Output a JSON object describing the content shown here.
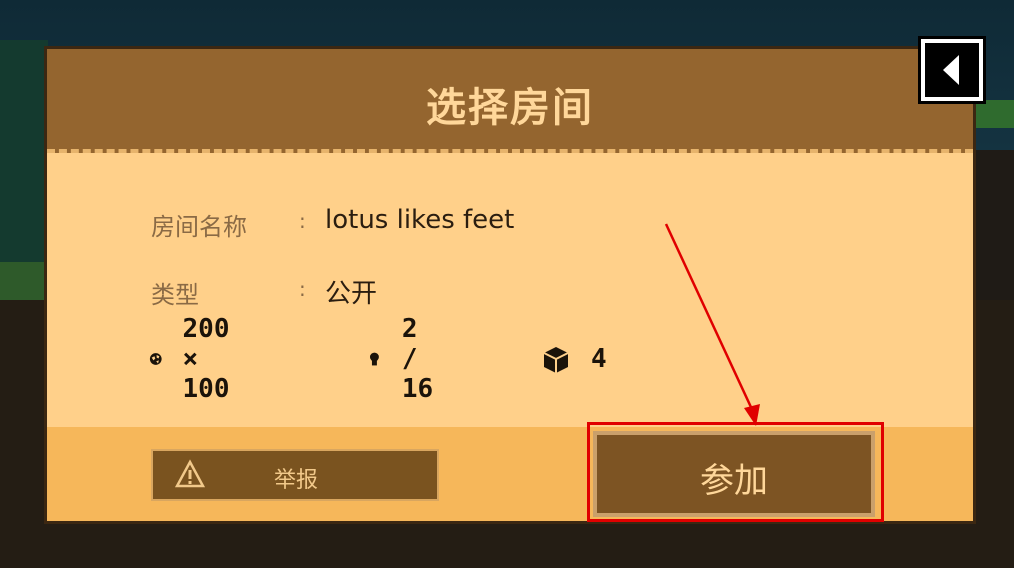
{
  "dialog": {
    "title": "选择房间",
    "fields": [
      {
        "label": "房间名称",
        "colon": ":",
        "value": "lotus likes feet"
      },
      {
        "label": "类型",
        "colon": ":",
        "value": "公开"
      }
    ],
    "stats": {
      "world_size": {
        "icon": "globe-icon",
        "text": "200 × 100"
      },
      "players": {
        "icon": "person-icon",
        "text": "2 / 16"
      },
      "blocks": {
        "icon": "cube-icon",
        "text": "4"
      }
    },
    "report_button": {
      "icon": "warning-icon",
      "label": "举报"
    },
    "join_button": {
      "label": "参加"
    }
  },
  "back_button": {
    "icon": "back-arrow-icon"
  },
  "colors": {
    "header": "#94652f",
    "panel": "#ffd08a",
    "footer": "#f6b75a",
    "button": "#7d5423",
    "highlight": "#e00000"
  }
}
